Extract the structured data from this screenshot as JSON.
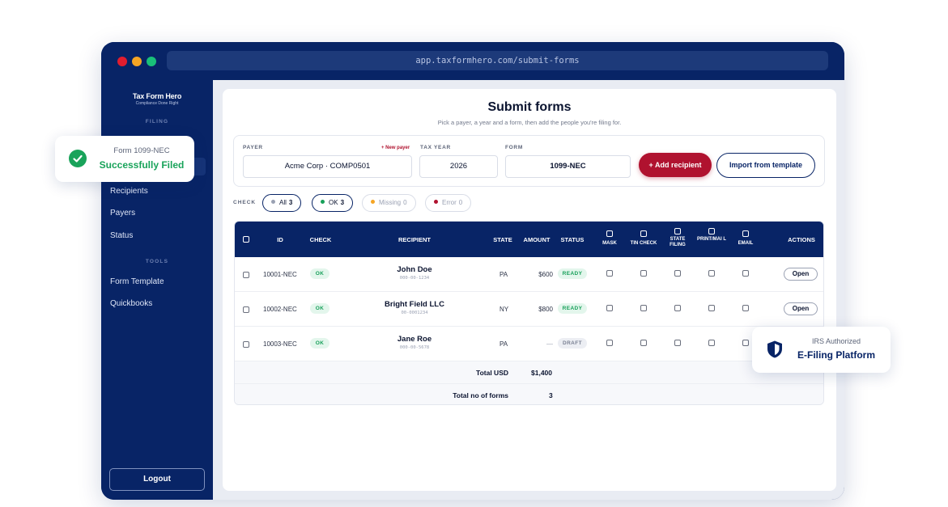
{
  "browser": {
    "url": "app.taxformhero.com/submit-forms"
  },
  "brand": {
    "name": "Tax Form Hero",
    "tagline": "Compliance Done Right"
  },
  "sidebar": {
    "section_filing": "FILING",
    "items": [
      {
        "label": "Recipients"
      },
      {
        "label": "Payers"
      },
      {
        "label": "Status"
      }
    ],
    "section_tools": "TOOLS",
    "tools": [
      {
        "label": "Form Template"
      },
      {
        "label": "Quickbooks"
      }
    ],
    "logout_label": "Logout"
  },
  "page": {
    "title": "Submit forms",
    "subtitle": "Pick a payer, a year and a form, then add the people you're filing for."
  },
  "filters": {
    "payer_label": "PAYER",
    "new_payer_link": "+ New payer",
    "payer_value": "Acme Corp · COMP0501",
    "tax_year_label": "TAX YEAR",
    "tax_year_value": "2026",
    "form_label": "FORM",
    "form_value": "1099-NEC",
    "add_recipient_label": "+ Add recipient",
    "import_label": "Import from template"
  },
  "check_filter": {
    "label": "CHECK",
    "chips": [
      {
        "label": "All",
        "count": "3",
        "color": "#9aa1b3"
      },
      {
        "label": "OK",
        "count": "3",
        "color": "#18a05a"
      },
      {
        "label": "Missing",
        "count": "0",
        "color": "#f5a524"
      },
      {
        "label": "Error",
        "count": "0",
        "color": "#b0122f"
      }
    ]
  },
  "table": {
    "headers": {
      "id": "ID",
      "check": "CHECK",
      "recipient": "RECIPIENT",
      "state": "STATE",
      "amount": "AMOUNT",
      "status": "STATUS",
      "mask": "MASK",
      "tin_check": "TIN CHECK",
      "state_filing": "STATE FILING",
      "print_mail": "PRINT/MAI L",
      "email": "EMAIL",
      "actions": "ACTIONS"
    },
    "rows": [
      {
        "id": "10001-NEC",
        "check": "OK",
        "name": "John Doe",
        "tin": "000-00-1234",
        "state": "PA",
        "amount": "$600",
        "status": "READY",
        "action": "Open"
      },
      {
        "id": "10002-NEC",
        "check": "OK",
        "name": "Bright Field LLC",
        "tin": "00-0001234",
        "state": "NY",
        "amount": "$800",
        "status": "READY",
        "action": "Open"
      },
      {
        "id": "10003-NEC",
        "check": "OK",
        "name": "Jane Roe",
        "tin": "000-00-5678",
        "state": "PA",
        "amount": "—",
        "status": "DRAFT",
        "action": ""
      }
    ],
    "total_usd_label": "Total USD",
    "total_usd_value": "$1,400",
    "total_forms_label": "Total no of forms",
    "total_forms_value": "3"
  },
  "toast_filed": {
    "subtitle": "Form 1099-NEC",
    "title": "Successfully Filed"
  },
  "badge_irs": {
    "subtitle": "IRS Authorized",
    "title": "E-Filing Platform"
  },
  "colors": {
    "navy": "#082466",
    "accent_red": "#b0122f",
    "success_green": "#19a35a"
  }
}
